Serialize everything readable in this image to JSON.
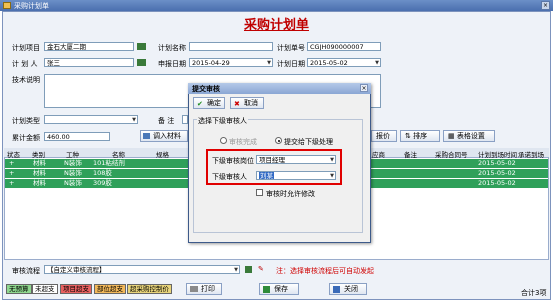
{
  "window": {
    "title": "采购计划单"
  },
  "form": {
    "title": "采购计划单"
  },
  "fields": {
    "project": {
      "label": "计划项目",
      "value": "金石大厦二期"
    },
    "planname": {
      "label": "计划名称",
      "value": ""
    },
    "planno": {
      "label": "计划单号",
      "value": "CGJH090000007"
    },
    "planner": {
      "label": "计 划 人",
      "value": "张三"
    },
    "applydate": {
      "label": "申报日期",
      "value": "2015-04-29"
    },
    "plandate": {
      "label": "计划日期",
      "value": "2015-05-02"
    },
    "tech": {
      "label": "技术说明",
      "value": ""
    },
    "plantype": {
      "label": "计划类型",
      "value": ""
    },
    "remark": {
      "label": "备  注",
      "value": ""
    },
    "total": {
      "label": "累计金额",
      "value": "460.00"
    }
  },
  "toolbar": {
    "import": "调入材料",
    "quote": "报价",
    "sort": "排序",
    "table_settings": "表格设置"
  },
  "table": {
    "headers": [
      "状态",
      "类别",
      "工种",
      "名称",
      "规格",
      "应商",
      "备注",
      "采购合同号",
      "计划到场时间",
      "承诺到场"
    ],
    "rows": [
      {
        "status": "+",
        "category": "材料",
        "trade": "N装饰",
        "name": "101粘结剂",
        "date": "2015-05-02"
      },
      {
        "status": "+",
        "category": "材料",
        "trade": "N装饰",
        "name": "108胶",
        "date": "2015-05-02"
      },
      {
        "status": "+",
        "category": "材料",
        "trade": "N装饰",
        "name": "309胶",
        "date": "2015-05-02"
      }
    ]
  },
  "approval": {
    "label": "审核流程",
    "value": "【自定义审核流程】",
    "note": "注：选择审核流程后可自动发起"
  },
  "legend": [
    "无预算",
    "未超支",
    "项目超支",
    "部位超支",
    "超采购控制价"
  ],
  "buttons": {
    "print": "打印",
    "save": "保存",
    "close": "关闭"
  },
  "record_count": "合计3项",
  "dialog": {
    "title": "提交审核",
    "confirm": "确定",
    "cancel": "取消",
    "group_label": "选择下级审核人",
    "radio_done": "审核完成",
    "radio_next": "提交给下级处理",
    "post_label": "下级审核岗位",
    "post_value": "项目经理",
    "user_label": "下级审核人",
    "user_value": "刘某",
    "allow_modify": "审核时允许修改"
  },
  "colors": {
    "accent": "#c00000",
    "row_green": "#2fa05a",
    "red_box": "#e00000"
  }
}
